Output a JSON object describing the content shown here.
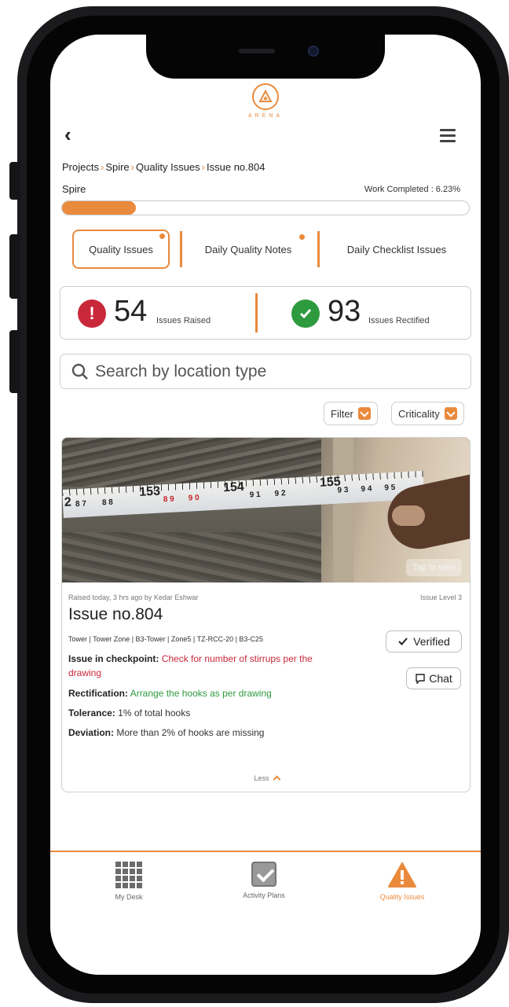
{
  "app": {
    "logo_text": "ARENA"
  },
  "breadcrumb": {
    "projects": "Projects",
    "project": "Spire",
    "section": "Quality Issues",
    "current": "Issue no.804"
  },
  "project": {
    "name": "Spire",
    "work_completed": "Work Completed : 6.23%",
    "progress": 0.0623
  },
  "tabs": [
    {
      "label": "Quality Issues",
      "active": true,
      "dot": true
    },
    {
      "label": "Daily Quality Notes",
      "active": false,
      "dot": true
    },
    {
      "label": "Daily Checklist Issues",
      "active": false,
      "dot": false
    }
  ],
  "stats": {
    "raised_count": "54",
    "raised_label": "Issues Raised",
    "rectified_count": "93",
    "rectified_label": "Issues Rectified"
  },
  "search": {
    "placeholder": "Search by location type"
  },
  "filters": {
    "filter_label": "Filter",
    "criticality_label": "Criticality"
  },
  "issue": {
    "photo_numbers": [
      "2",
      "8 7",
      "8 8",
      "153",
      "8 9",
      "9 0",
      "154",
      "9 1",
      "9 2",
      "155",
      "9 3",
      "9 4",
      "9 5"
    ],
    "tap_to_view": "Tap to view",
    "raised_by": "Raised today, 3 hrs ago by Kedar Eshwar",
    "level": "Issue Level 3",
    "title": "Issue no.804",
    "location": "Tower | Tower Zone | B3-Tower | Zone5 | TZ-RCC-20 | B3-C25",
    "verified_label": "Verified",
    "chat_label": "Chat",
    "checkpoint_label": "Issue in checkpoint:",
    "checkpoint_line1": "Check for number of stirrups per the",
    "checkpoint_line2": "drawing",
    "rectification_label": "Rectification:",
    "rectification_value": "Arrange the hooks as per drawing",
    "tolerance_label": "Tolerance:",
    "tolerance_value": "1% of total hooks",
    "deviation_label": "Deviation:",
    "deviation_value": "More than 2% of hooks are missing",
    "less_label": "Less"
  },
  "bottom_nav": [
    {
      "label": "My Desk",
      "icon": "grid-icon",
      "active": false
    },
    {
      "label": "Activity Plans",
      "icon": "checkbox-icon",
      "active": false
    },
    {
      "label": "Quality Issues",
      "icon": "warning-icon",
      "active": true
    }
  ],
  "colors": {
    "accent": "#e98a3c",
    "danger": "#c9283b",
    "success": "#2e9a3e"
  }
}
